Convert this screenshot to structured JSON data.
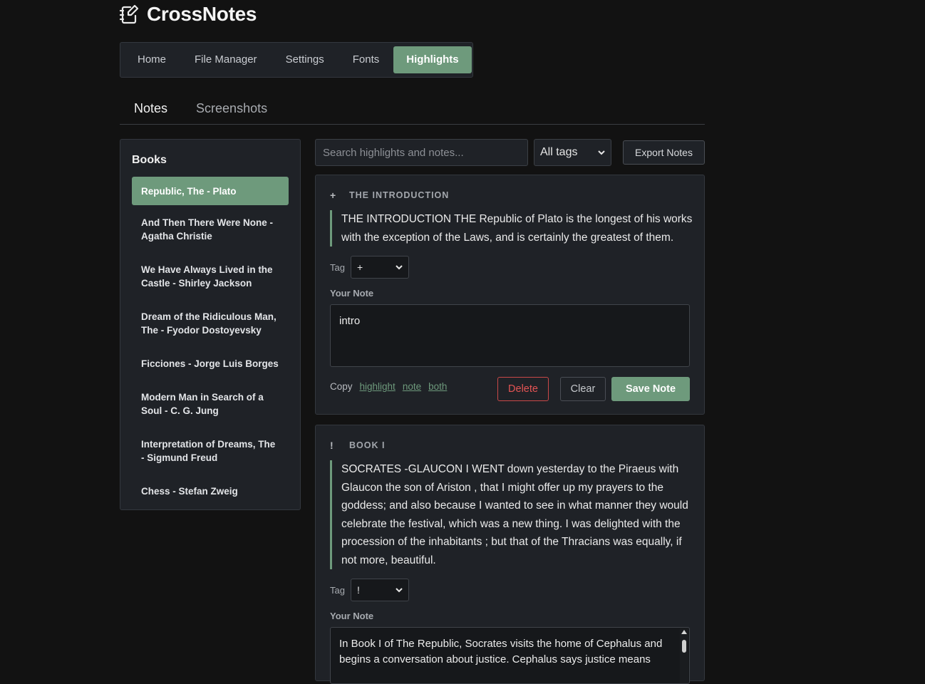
{
  "app": {
    "title": "CrossNotes",
    "logo_icon": "notebook-pen-icon"
  },
  "nav": {
    "items": [
      {
        "label": "Home",
        "active": false
      },
      {
        "label": "File Manager",
        "active": false
      },
      {
        "label": "Settings",
        "active": false
      },
      {
        "label": "Fonts",
        "active": false
      },
      {
        "label": "Highlights",
        "active": true
      }
    ]
  },
  "tabs": [
    {
      "label": "Notes",
      "active": true
    },
    {
      "label": "Screenshots",
      "active": false
    }
  ],
  "books": {
    "title": "Books",
    "items": [
      {
        "label": "Republic, The - Plato",
        "active": true
      },
      {
        "label": "And Then There Were None - Agatha Christie",
        "active": false
      },
      {
        "label": "We Have Always Lived in the Castle - Shirley Jackson",
        "active": false
      },
      {
        "label": "Dream of the Ridiculous Man, The - Fyodor Dostoyevsky",
        "active": false
      },
      {
        "label": "Ficciones - Jorge Luis Borges",
        "active": false
      },
      {
        "label": "Modern Man in Search of a Soul - C. G. Jung",
        "active": false
      },
      {
        "label": "Interpretation of Dreams, The - Sigmund Freud",
        "active": false
      },
      {
        "label": "Chess - Stefan Zweig",
        "active": false
      }
    ]
  },
  "toolbar": {
    "search_placeholder": "Search highlights and notes...",
    "search_value": "",
    "tag_filter": "All tags",
    "export_label": "Export Notes"
  },
  "highlights": [
    {
      "icon": "+",
      "heading": "THE INTRODUCTION",
      "quote": "THE INTRODUCTION THE Republic of Plato is the longest of his works with the exception of the Laws, and is certainly the greatest of them.",
      "tag_label": "Tag",
      "tag_value": "+",
      "note_label": "Your Note",
      "note": "intro",
      "copy_label": "Copy",
      "copy_highlight": "highlight",
      "copy_note": "note",
      "copy_both": "both",
      "delete_label": "Delete",
      "clear_label": "Clear",
      "save_label": "Save Note"
    },
    {
      "icon": "!",
      "heading": "BOOK I",
      "quote": "SOCRATES -GLAUCON I WENT down yesterday to the Piraeus with Glaucon the son of Ariston , that I might offer up my prayers to the goddess; and also because I wanted to see in what manner they would celebrate the festival, which was a new thing. I was delighted with the procession of the inhabitants ; but that of the Thracians was equally, if not more, beautiful.",
      "tag_label": "Tag",
      "tag_value": "!",
      "note_label": "Your Note",
      "note": "In Book I of The Republic, Socrates visits the home of Cephalus and begins a conversation about justice. Cephalus says justice means"
    }
  ],
  "colors": {
    "accent": "#6e9a7c",
    "danger": "#e35454",
    "background": "#121212",
    "panel": "#1f2227"
  }
}
